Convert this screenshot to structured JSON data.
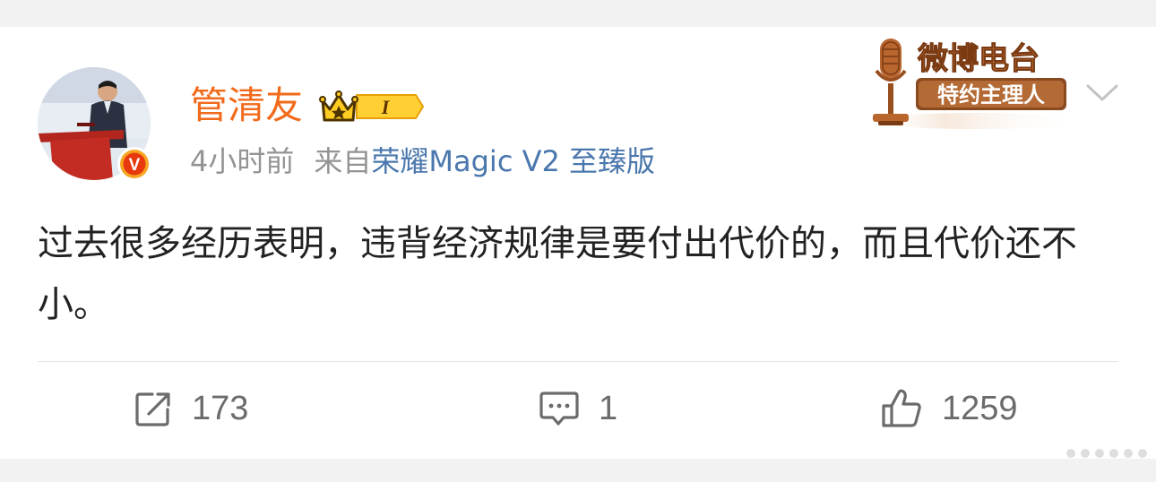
{
  "post": {
    "username": "管清友",
    "level": "I",
    "time": "4小时前",
    "source_prefix": "来自",
    "device": "荣耀Magic V2 至臻版",
    "text": "过去很多经历表明，违背经济规律是要付出代价的，而且代价还不小。"
  },
  "verified_mark": "V",
  "radio_badge": {
    "title": "微博电台",
    "subtitle": "特约主理人"
  },
  "actions": {
    "forward_count": "173",
    "comment_count": "1",
    "like_count": "1259"
  },
  "colors": {
    "username": "#f26a1b",
    "link": "#4a77ad",
    "meta_gray": "#939393",
    "text": "#222222",
    "icon_gray": "#6b6b6b"
  },
  "icons": {
    "forward": "share-edit-icon",
    "comment": "comment-icon",
    "like": "thumbs-up-icon",
    "more": "chevron-down-icon"
  }
}
